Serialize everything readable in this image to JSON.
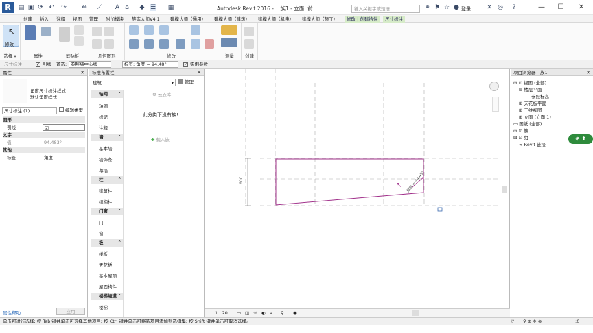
{
  "app": {
    "title": "Autodesk Revit 2016 -",
    "document": "族1 - 立面: 前"
  },
  "search": {
    "placeholder": "键入关键字或短语"
  },
  "user": {
    "label": "登录"
  },
  "tabs": [
    "创建",
    "插入",
    "注释",
    "视图",
    "管理",
    "附加模块",
    "族库大师V4.1",
    "建模大师（通用）",
    "建模大师（建筑）",
    "建模大师（机电）",
    "建模大师（施工）",
    "修改 | 创建拾件",
    "尺寸标注"
  ],
  "ribbon": {
    "groups": [
      "选择",
      "属性",
      "剪贴板",
      "几何图形",
      "修改",
      "测量",
      "创建"
    ],
    "modify_label": "修改",
    "select_dropdown": "选择 ▾"
  },
  "optionsbar": {
    "label": "尺寸标注",
    "leader_label": "引线",
    "first_label": "首选:",
    "first_value": "参照墙中心线",
    "dim_label": "标签: 角度 = 94.48°",
    "instance_label": "实例参数"
  },
  "properties": {
    "header": "属性",
    "type_name": "角度尺寸标注样式",
    "type_sub": "默认角度样式",
    "selector": "尺寸标注 (1)",
    "edit_type": "编辑类型",
    "groups": [
      "图形",
      "文字",
      "其他"
    ],
    "rows": [
      {
        "name": "引线",
        "value": "☑"
      },
      {
        "name": "值",
        "value": "94.483°"
      },
      {
        "name": "标签",
        "value": "角度"
      }
    ],
    "help": "属性帮助",
    "apply": "应用"
  },
  "family_browser": {
    "header": "标准布置栏",
    "filter": "建筑",
    "manage": "管理",
    "cloud": "云族库",
    "empty_text": "此分类下没有族!",
    "load": "载入族",
    "categories": [
      {
        "name": "轴网",
        "items": [
          "轴网",
          "标记",
          "注释"
        ]
      },
      {
        "name": "墙",
        "items": [
          "基本墙",
          "墙饰条",
          "幕墙"
        ]
      },
      {
        "name": "柱",
        "items": [
          "建筑柱",
          "结构柱"
        ]
      },
      {
        "name": "门窗",
        "items": [
          "门",
          "窗"
        ]
      },
      {
        "name": "板",
        "items": [
          "楼板",
          "天花板",
          "基本屋顶",
          "屋面构件"
        ]
      },
      {
        "name": "楼梯坡道",
        "items": [
          "楼梯"
        ]
      }
    ]
  },
  "canvas": {
    "dimension_text": "角度 = 94.48°",
    "scale": "1 : 20"
  },
  "project_browser": {
    "header": "项目浏览器 - 族1",
    "items": [
      "视图 (全部)",
      "楼层平面",
      "参照标高",
      "天花板平面",
      "三维视图",
      "立面 (立面 1)",
      "图纸 (全部)",
      "族",
      "组",
      "Revit 链接"
    ]
  },
  "status": {
    "text": "单击可进行选择; 按 Tab 键并单击可选择其他项目; 按 Ctrl 键并单击可将新项目添加到选择集; 按 Shift 键并单击可取消选择。",
    "zoom": ":0"
  },
  "colors": {
    "accent": "#d6ebc8",
    "sketch": "#a0308a",
    "panel": "#e8e8e8"
  }
}
